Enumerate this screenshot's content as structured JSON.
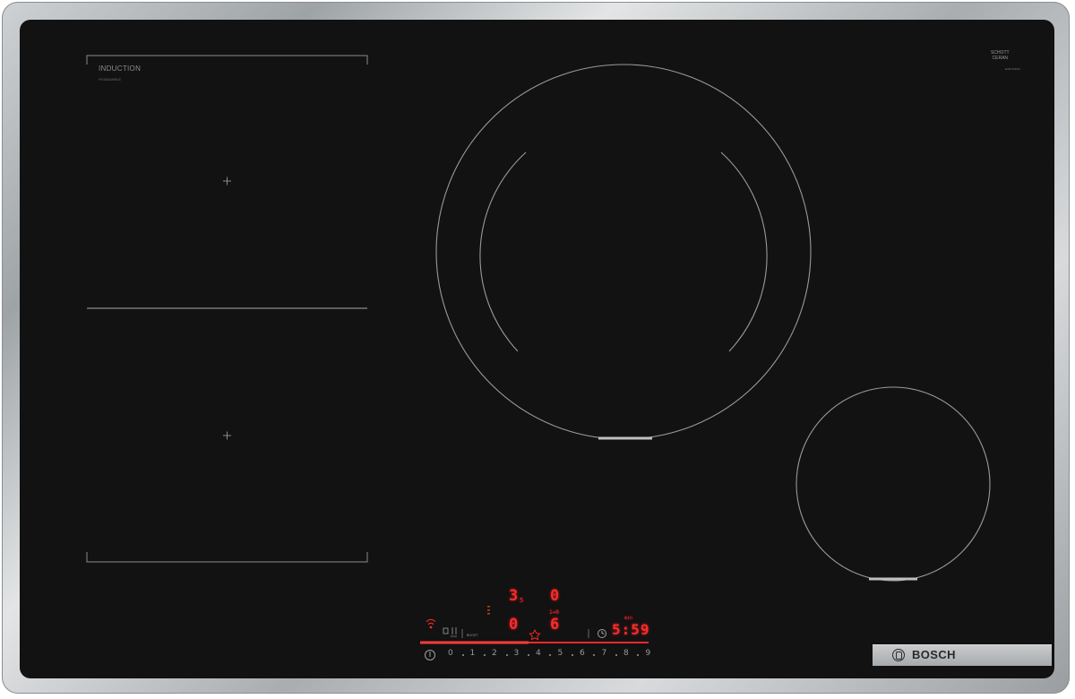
{
  "cooktop": {
    "flex_zone_label": "INDUCTION",
    "model_code": "PVS845HB1E",
    "glass_brand_line1": "SCHOTT",
    "glass_brand_line2": "CERAN",
    "glass_brand_sub": "EUROKERA",
    "brand": "BOSCH"
  },
  "controls": {
    "timer_left": "3",
    "timer_left_sub": "5",
    "timer_right": "0",
    "zone_left_level": "0",
    "zone_right_level": "6",
    "zone_right_indicator": "1↛0",
    "clock": "5:59",
    "clock_label": "min",
    "scale": [
      "0",
      "1",
      "2",
      "3",
      "4",
      "5",
      "6",
      "7",
      "8",
      "9"
    ],
    "mode_left_label": "Pirat",
    "boost_label": "BOOST"
  },
  "colors": {
    "glass": "#121212",
    "frame": "#b8bbbe",
    "led_red": "#ff2a2a",
    "zone_lines": "#8a8a8a"
  },
  "icons": {
    "power": "power-icon",
    "wifi": "wifi-icon",
    "favorite": "star-icon",
    "timer": "clock-icon"
  }
}
